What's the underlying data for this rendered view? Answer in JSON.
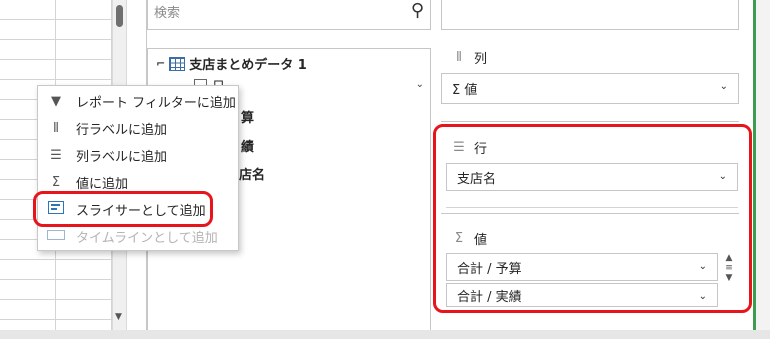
{
  "search": {
    "placeholder": "検索"
  },
  "field_list": {
    "table_name": "支店まとめデータ 1",
    "first_field": "日",
    "partial_fields": [
      "算",
      "績",
      "店名"
    ]
  },
  "context_menu": {
    "items": [
      {
        "icon": "filter-icon",
        "label": "レポート フィルターに追加",
        "enabled": true
      },
      {
        "icon": "row-label-icon",
        "label": "行ラベルに追加",
        "enabled": true
      },
      {
        "icon": "column-label-icon",
        "label": "列ラベルに追加",
        "enabled": true
      },
      {
        "icon": "sigma-icon",
        "label": "値に追加",
        "enabled": true
      },
      {
        "icon": "slicer-icon",
        "label": "スライサーとして追加",
        "enabled": true,
        "highlighted": true
      },
      {
        "icon": "timeline-icon",
        "label": "タイムラインとして追加",
        "enabled": false
      }
    ]
  },
  "areas": {
    "columns": {
      "title": "列",
      "value": "Σ 値"
    },
    "rows": {
      "title": "行",
      "value": "支店名"
    },
    "values": {
      "title": "値",
      "items": [
        "合計 / 予算",
        "合計 / 実績"
      ]
    }
  },
  "colors": {
    "highlight_red": "#e8141c",
    "pane_green_edge": "#3f9b52",
    "slicer_blue": "#2e75b6"
  }
}
